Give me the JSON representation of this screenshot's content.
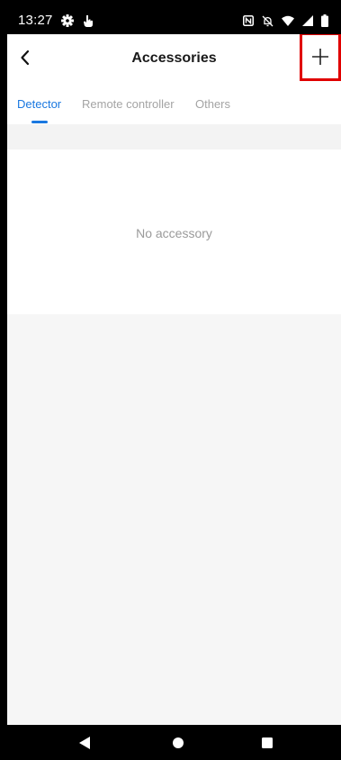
{
  "status_bar": {
    "time": "13:27",
    "left_icons": [
      "settings-gear-icon",
      "hand-touch-icon"
    ],
    "right_icons": [
      "nfc-icon",
      "mute-bell-icon",
      "wifi-icon",
      "cell-signal-icon",
      "battery-icon"
    ]
  },
  "header": {
    "back_icon": "chevron-left-icon",
    "title": "Accessories",
    "add_icon": "plus-icon"
  },
  "tabs": [
    {
      "label": "Detector",
      "active": true
    },
    {
      "label": "Remote controller",
      "active": false
    },
    {
      "label": "Others",
      "active": false
    }
  ],
  "empty_state": {
    "message": "No accessory"
  },
  "nav_bar": {
    "buttons": [
      "back-triangle-icon",
      "home-circle-icon",
      "recents-square-icon"
    ]
  },
  "colors": {
    "accent": "#1a78e0",
    "tab_inactive": "#a4a4a4",
    "highlight_box": "#e00000",
    "background": "#f6f6f6"
  }
}
